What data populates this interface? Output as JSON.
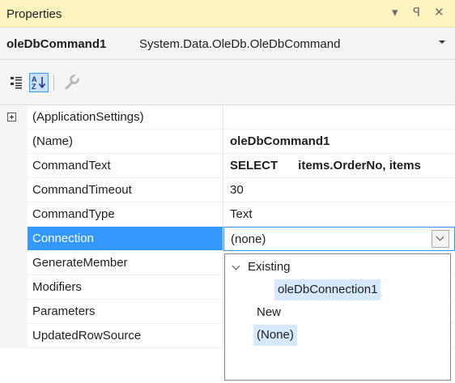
{
  "panel": {
    "title": "Properties",
    "dropdown_glyph": "▾",
    "pin_glyph": "ꟼ",
    "close_glyph": "✕"
  },
  "object": {
    "name": "oleDbCommand1",
    "type": "System.Data.OleDb.OleDbCommand"
  },
  "toolbar": {
    "categorized_icon": "categorized-icon",
    "alphabetical_icon": "alphabetical-icon",
    "alphabetical_selected": true,
    "events_icon": "wrench-icon"
  },
  "properties": [
    {
      "name": "(ApplicationSettings)",
      "value": "",
      "expandable": true
    },
    {
      "name": "(Name)",
      "value": "oleDbCommand1",
      "bold": true
    },
    {
      "name": "CommandText",
      "value": "SELECT      items.OrderNo, items",
      "bold": true
    },
    {
      "name": "CommandTimeout",
      "value": "30"
    },
    {
      "name": "CommandType",
      "value": "Text"
    },
    {
      "name": "Connection",
      "value": "(none)",
      "selected": true
    },
    {
      "name": "GenerateMember",
      "value": ""
    },
    {
      "name": "Modifiers",
      "value": ""
    },
    {
      "name": "Parameters",
      "value": ""
    },
    {
      "name": "UpdatedRowSource",
      "value": ""
    }
  ],
  "connection_dropdown": {
    "group_label": "Existing",
    "existing_items": [
      "oleDbConnection1"
    ],
    "new_label": "New",
    "none_label": "(None)"
  },
  "colors": {
    "title_bar": "#fdf4bf",
    "selection": "#3399ff",
    "highlight": "#d6e8fb"
  }
}
